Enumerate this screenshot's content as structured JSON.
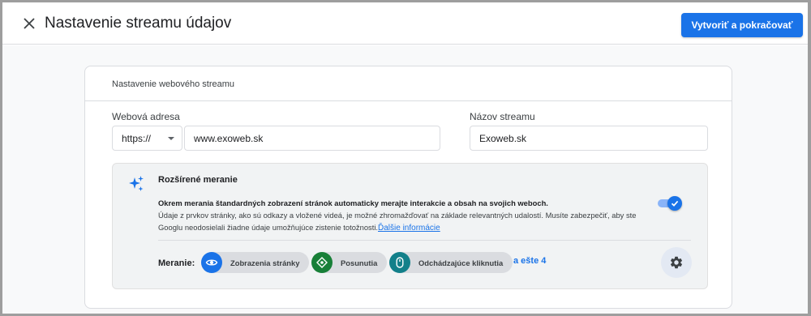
{
  "header": {
    "title": "Nastavenie streamu údajov",
    "primary_button": "Vytvoriť a pokračovať",
    "close_icon": "close-icon"
  },
  "card": {
    "title": "Nastavenie webového streamu",
    "web_address": {
      "label": "Webová adresa",
      "protocol": "https://",
      "value": "www.exoweb.sk"
    },
    "stream_name": {
      "label": "Názov streamu",
      "value": "Exoweb.sk"
    }
  },
  "enhanced_measurement": {
    "icon": "sparkle-icon",
    "title": "Rozšírené meranie",
    "description_lead": "Okrem merania štandardných zobrazení stránok automaticky merajte interakcie a obsah na svojich weboch.",
    "description_body": "Údaje z prvkov stránky, ako sú odkazy a vložené videá, je možné zhromažďovať na základe relevantných udalostí. Musíte zabezpečiť, aby ste Googlu neodosielali žiadne údaje umožňujúce zistenie totožnosti.",
    "learn_more": "Ďalšie informácie",
    "toggle_on": true,
    "measurement_label": "Meranie:",
    "chips": [
      {
        "label": "Zobrazenia stránky",
        "icon": "eye-icon",
        "color": "#1a73e8"
      },
      {
        "label": "Posunutia",
        "icon": "scroll-target-icon",
        "color": "#188038"
      },
      {
        "label": "Odchádzajúce kliknutia",
        "icon": "mouse-icon",
        "color": "#12808a"
      }
    ],
    "more": "a ešte 4",
    "settings_icon": "gear-icon"
  },
  "colors": {
    "primary": "#1a73e8",
    "background": "#f8f9fa"
  }
}
